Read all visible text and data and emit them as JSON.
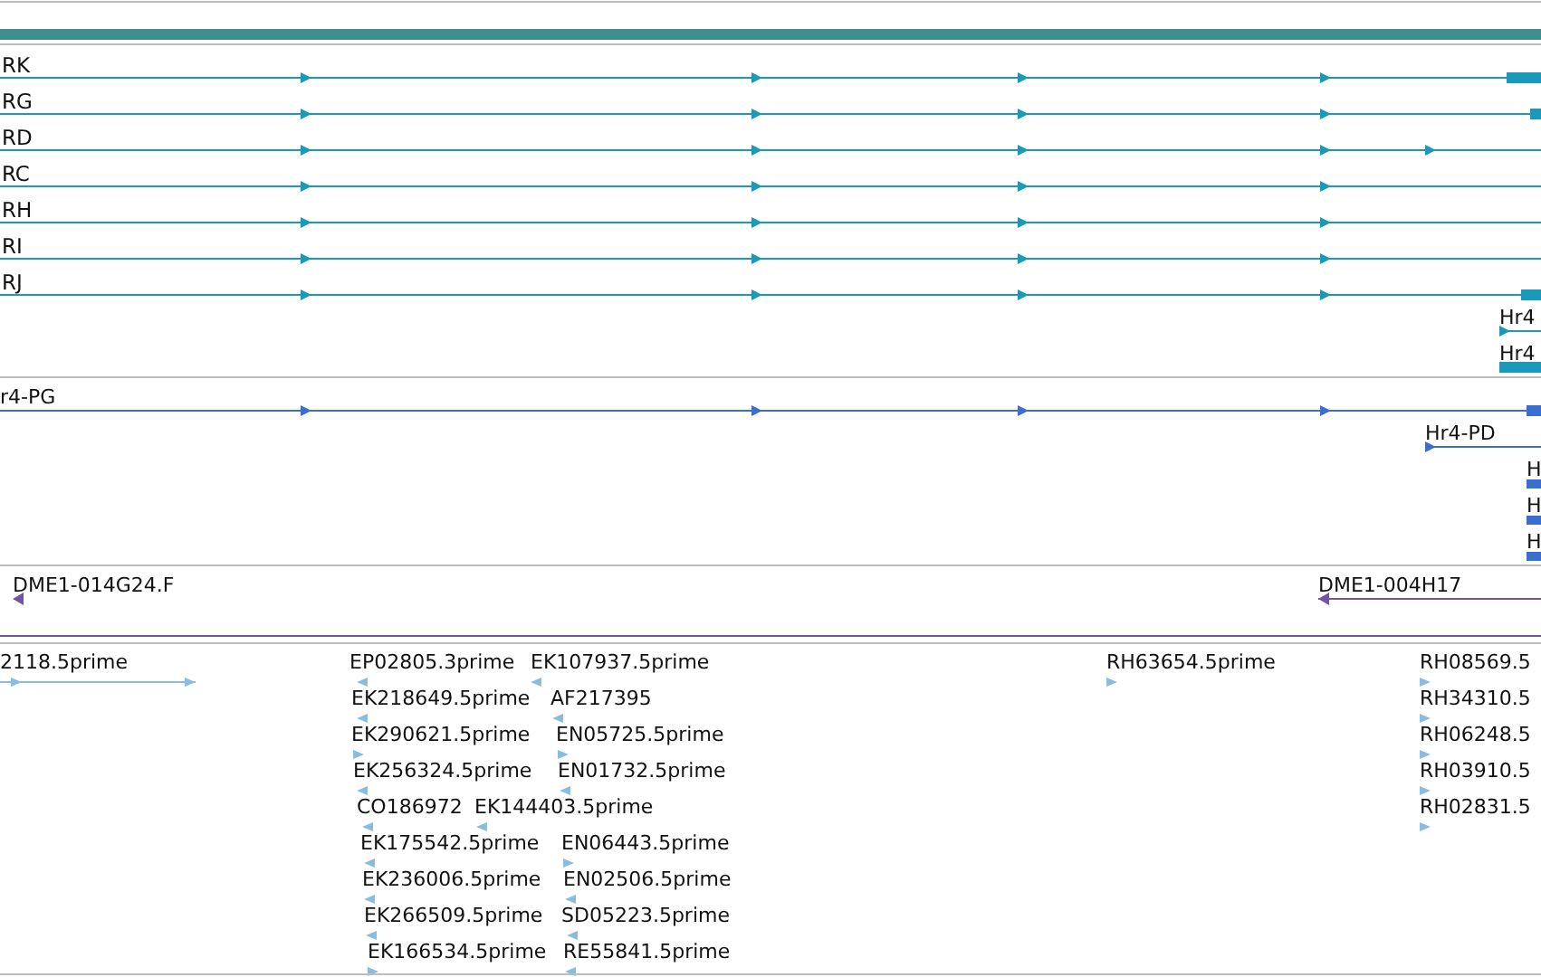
{
  "transcripts": [
    {
      "label": "RK"
    },
    {
      "label": "RG"
    },
    {
      "label": "RD"
    },
    {
      "label": "RC"
    },
    {
      "label": "RH"
    },
    {
      "label": "RI"
    },
    {
      "label": "RJ"
    }
  ],
  "hr4_features": [
    {
      "label": "Hr4"
    },
    {
      "label": "Hr4"
    }
  ],
  "protein_features": [
    {
      "label": "r4-PG"
    },
    {
      "label": "Hr4-PD"
    },
    {
      "label": "H"
    },
    {
      "label": "H"
    },
    {
      "label": "H"
    }
  ],
  "clones": [
    {
      "label": "DME1-014G24.F"
    },
    {
      "label": "DME1-004H17"
    }
  ],
  "ests": [
    {
      "label": "2118.5prime",
      "reverse": false
    },
    {
      "label": "EP02805.3prime",
      "reverse": true
    },
    {
      "label": "EK107937.5prime",
      "reverse": true
    },
    {
      "label": "EK218649.5prime",
      "reverse": true
    },
    {
      "label": "AF217395",
      "reverse": true
    },
    {
      "label": "EK290621.5prime",
      "reverse": false
    },
    {
      "label": "EN05725.5prime",
      "reverse": false
    },
    {
      "label": "EK256324.5prime",
      "reverse": true
    },
    {
      "label": "EN01732.5prime",
      "reverse": true
    },
    {
      "label": "CO186972",
      "reverse": true
    },
    {
      "label": "EK144403.5prime",
      "reverse": true
    },
    {
      "label": "EK175542.5prime",
      "reverse": true
    },
    {
      "label": "EN06443.5prime",
      "reverse": false
    },
    {
      "label": "EK236006.5prime",
      "reverse": true
    },
    {
      "label": "EN02506.5prime",
      "reverse": true
    },
    {
      "label": "EK266509.5prime",
      "reverse": true
    },
    {
      "label": "SD05223.5prime",
      "reverse": true
    },
    {
      "label": "EK166534.5prime",
      "reverse": false
    },
    {
      "label": "RE55841.5prime",
      "reverse": true
    },
    {
      "label": "RH63654.5prime",
      "reverse": false
    },
    {
      "label": "RH08569.5",
      "reverse": false
    },
    {
      "label": "RH34310.5",
      "reverse": false
    },
    {
      "label": "RH06248.5",
      "reverse": false
    },
    {
      "label": "RH03910.5",
      "reverse": false
    },
    {
      "label": "RH02831.5",
      "reverse": false
    }
  ]
}
